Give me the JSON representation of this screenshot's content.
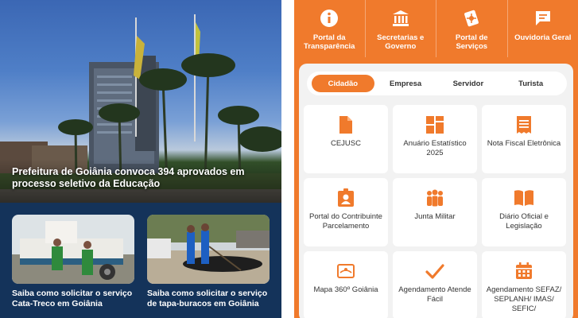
{
  "news": {
    "featured": {
      "headline": "Prefeitura de Goiânia convoca 394 aprovados em processo seletivo da Educação"
    },
    "items": [
      {
        "caption": "Saiba como solicitar o serviço Cata-Treco em Goiânia"
      },
      {
        "caption": "Saiba como solicitar o serviço de tapa-buracos em Goiânia"
      }
    ]
  },
  "topnav": {
    "items": [
      {
        "label": "Portal da Transparência",
        "icon": "info-icon"
      },
      {
        "label": "Secretarias e Governo",
        "icon": "government-building-icon"
      },
      {
        "label": "Portal de Serviços",
        "icon": "services-icon"
      },
      {
        "label": "Ouvidoria Geral",
        "icon": "chat-icon"
      }
    ]
  },
  "tabs": {
    "items": [
      "Cidadão",
      "Empresa",
      "Servidor",
      "Turista"
    ],
    "active": "Cidadão"
  },
  "services": {
    "items": [
      {
        "label": "CEJUSC",
        "icon": "document-icon"
      },
      {
        "label": "Anuário Estatístico 2025",
        "icon": "grid-icon"
      },
      {
        "label": "Nota Fiscal Eletrônica",
        "icon": "receipt-icon"
      },
      {
        "label": "Portal do Contribuinte Parcelamento",
        "icon": "user-badge-icon"
      },
      {
        "label": "Junta Militar",
        "icon": "group-icon"
      },
      {
        "label": "Diário Oficial e Legislação",
        "icon": "book-icon"
      },
      {
        "label": "Mapa 360º Goiânia",
        "icon": "map-360-icon"
      },
      {
        "label": "Agendamento Atende Fácil",
        "icon": "checkmark-icon"
      },
      {
        "label": "Agendamento SEFAZ/ SEPLANH/ IMAS/ SEFIC/",
        "icon": "calendar-icon"
      }
    ]
  },
  "colors": {
    "accent": "#f07a2c",
    "news_bg": "#14335a",
    "panel_bg": "#f2f2f2"
  }
}
